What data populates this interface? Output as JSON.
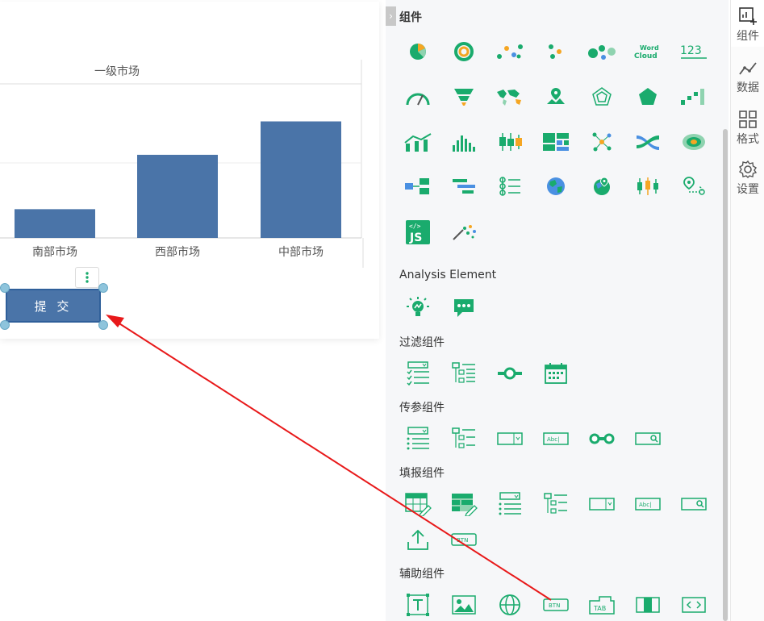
{
  "chart_data": {
    "type": "bar",
    "title": "一级市场",
    "categories": [
      "南部市场",
      "西部市场",
      "中部市场"
    ],
    "values": [
      37,
      107,
      150
    ],
    "ylim": [
      0,
      190
    ],
    "series_color": "#4a74a8"
  },
  "canvas": {
    "submit_label": "提 交"
  },
  "panel": {
    "title": "组件",
    "sections": {
      "analysis": "Analysis Element",
      "filter": "过滤组件",
      "param": "传参组件",
      "fill": "填报组件",
      "aux": "辅助组件"
    }
  },
  "rightbar": {
    "items": [
      {
        "label": "组件",
        "icon": "add-component-icon"
      },
      {
        "label": "数据",
        "icon": "data-line-icon"
      },
      {
        "label": "格式",
        "icon": "grid-format-icon"
      },
      {
        "label": "设置",
        "icon": "gear-icon"
      }
    ]
  },
  "colors": {
    "accent": "#1aab6d",
    "chart": "#4a74a8",
    "arrow": "#e8191a"
  }
}
